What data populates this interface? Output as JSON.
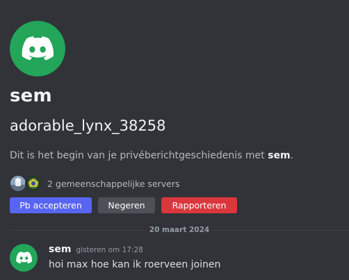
{
  "colors": {
    "avatar_bg": "#23a55a",
    "accept": "#5865f2",
    "ignore": "#4e5058",
    "report": "#da373c",
    "background": "#313338"
  },
  "profile": {
    "avatar_icon": "discord-logo-icon",
    "display_name": "sem",
    "username": "adorable_lynx_38258",
    "intro_prefix": "Dit is het begin van je privéberichtgeschiedenis met ",
    "intro_name": "sem",
    "intro_suffix": "."
  },
  "mutual": {
    "servers": [
      {
        "icon": "server-icon-1",
        "color": "#8fa6bf"
      },
      {
        "icon": "server-icon-2",
        "color": "#3a6b3d"
      }
    ],
    "text": "2 gemeenschappelijke servers"
  },
  "actions": {
    "accept_label": "Pb accepteren",
    "ignore_label": "Negeren",
    "report_label": "Rapporteren"
  },
  "divider": {
    "date": "20 maart 2024"
  },
  "message": {
    "avatar_icon": "discord-logo-icon",
    "author": "sem",
    "timestamp": "gisteren om 17:28",
    "text": "hoi max hoe kan ik roerveen joinen"
  }
}
